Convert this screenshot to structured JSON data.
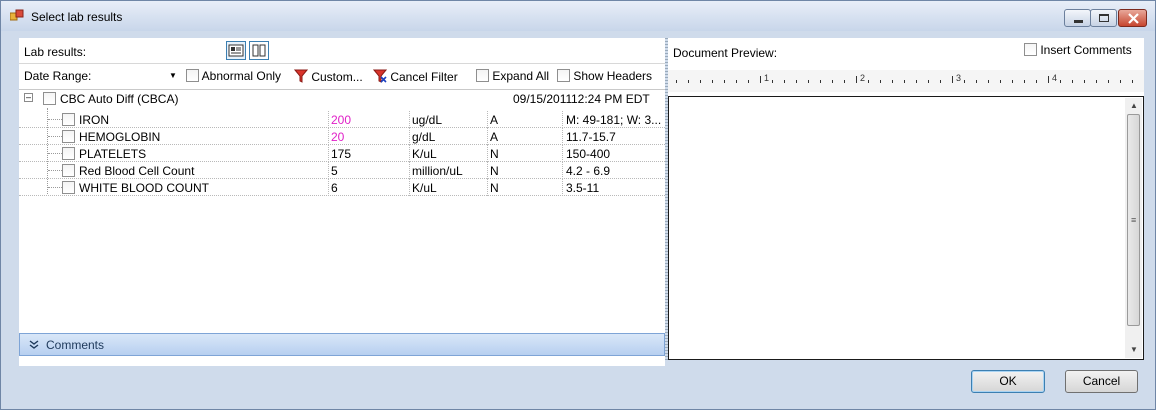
{
  "window": {
    "title": "Select lab results"
  },
  "lab_panel": {
    "label": "Lab results:",
    "filter": {
      "date_range_label": "Date Range:",
      "abnormal_only": "Abnormal Only",
      "custom": "Custom...",
      "cancel_filter": "Cancel Filter",
      "expand_all": "Expand All",
      "show_headers": "Show Headers"
    },
    "group": {
      "name": "CBC Auto Diff (CBCA)",
      "date": "09/15/2011",
      "time": "12:24 PM EDT"
    },
    "results": [
      {
        "name": "IRON",
        "value": "200",
        "unit": "ug/dL",
        "flag": "A",
        "range": "M: 49-181; W: 3...",
        "abnormal": true
      },
      {
        "name": "HEMOGLOBIN",
        "value": "20",
        "unit": "g/dL",
        "flag": "A",
        "range": "11.7-15.7",
        "abnormal": true
      },
      {
        "name": "PLATELETS",
        "value": "175",
        "unit": "K/uL",
        "flag": "N",
        "range": "150-400",
        "abnormal": false
      },
      {
        "name": "Red Blood Cell Count",
        "value": "5",
        "unit": "million/uL",
        "flag": "N",
        "range": "4.2 - 6.9",
        "abnormal": false
      },
      {
        "name": "WHITE BLOOD COUNT",
        "value": "6",
        "unit": "K/uL",
        "flag": "N",
        "range": "3.5-11",
        "abnormal": false
      }
    ],
    "comments_label": "Comments"
  },
  "doc_panel": {
    "label": "Document Preview:",
    "insert_comments": "Insert Comments",
    "ruler_numbers": [
      "1",
      "2",
      "3",
      "4"
    ]
  },
  "buttons": {
    "ok": "OK",
    "cancel": "Cancel"
  },
  "colors": {
    "abnormal_value": "#e020c8",
    "accent": "#3c7fb1"
  }
}
